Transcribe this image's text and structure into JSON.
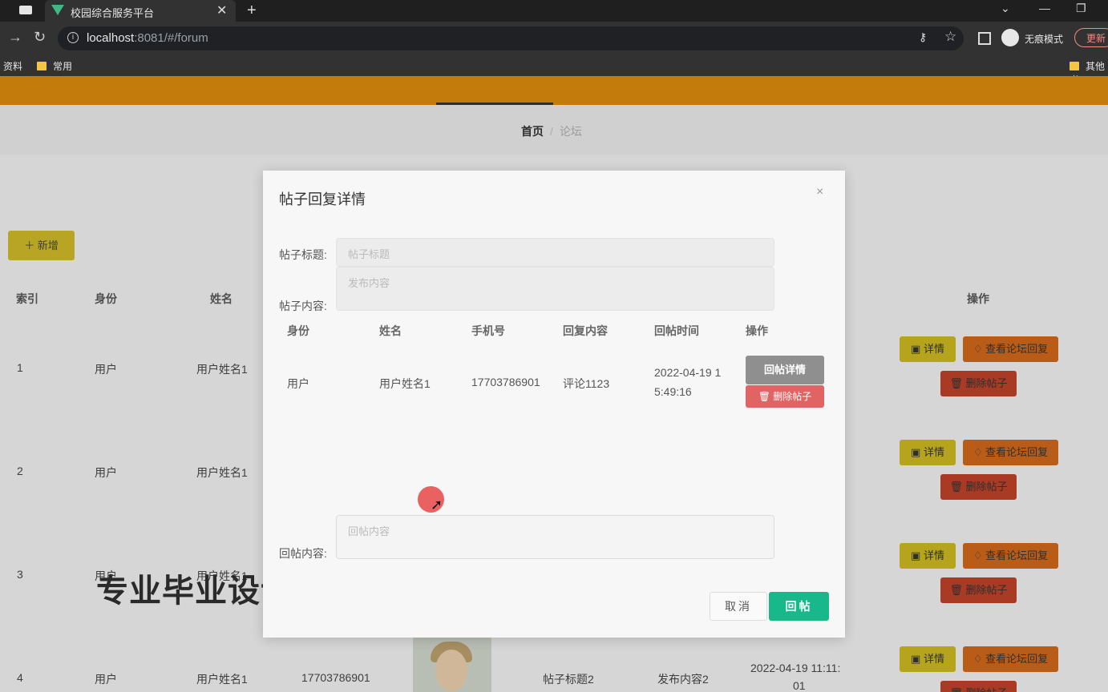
{
  "browser": {
    "tab_title": "校园综合服务平台",
    "url_host": "localhost",
    "url_rest": ":8081/#/forum",
    "incognito_label": "无痕模式",
    "update_label": "更新",
    "bookmarks": [
      "资料",
      "常用",
      "其他书"
    ]
  },
  "breadcrumb": {
    "home": "首页",
    "sep": "/",
    "current": "论坛"
  },
  "add_button": "＋ 新增",
  "table": {
    "headers": {
      "index": "索引",
      "identity": "身份",
      "name": "姓名",
      "actions": "操作"
    },
    "rows": [
      {
        "index": "1",
        "identity": "用户",
        "name": "用户姓名1"
      },
      {
        "index": "2",
        "identity": "用户",
        "name": "用户姓名1"
      },
      {
        "index": "3",
        "identity": "用户",
        "name": "用户姓名1"
      },
      {
        "index": "4",
        "identity": "用户",
        "name": "用户姓名1",
        "phone": "17703786901",
        "title": "帖子标题2",
        "content": "发布内容2",
        "time_line1": "2022-04-19 11:11:",
        "time_line2": "01"
      }
    ],
    "row_buttons": {
      "detail": "▣ 详情",
      "view_replies": "♢ 查看论坛回复",
      "delete": "🗑 删除帖子"
    }
  },
  "watermark": "专业毕业设计代做",
  "dialog": {
    "title": "帖子回复详情",
    "close": "×",
    "post_title_label": "帖子标题:",
    "post_title_placeholder": "帖子标题",
    "post_content_label": "帖子内容:",
    "post_content_placeholder": "发布内容",
    "reply_headers": {
      "identity": "身份",
      "name": "姓名",
      "phone": "手机号",
      "content": "回复内容",
      "time": "回帖时间",
      "actions": "操作"
    },
    "reply_row": {
      "identity": "用户",
      "name": "用户姓名1",
      "phone": "17703786901",
      "content": "评论1123",
      "time_line1": "2022-04-19 1",
      "time_line2": "5:49:16"
    },
    "reply_detail_button": "回帖详情",
    "delete_post_button": "🗑 删除帖子",
    "reply_content_label": "回帖内容:",
    "reply_content_placeholder": "回帖内容",
    "cancel_button": "取消",
    "reply_button": "回帖"
  }
}
